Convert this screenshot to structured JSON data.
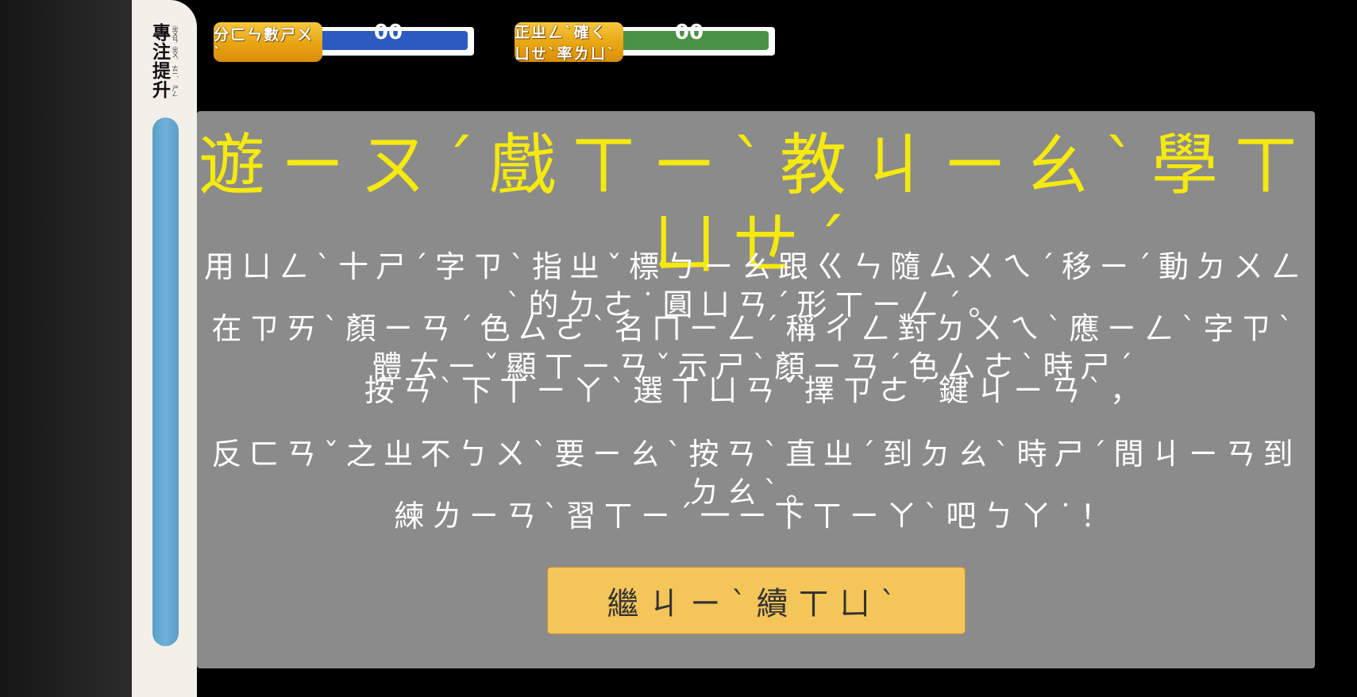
{
  "sidebar": {
    "title_chars": [
      {
        "han": "專",
        "bpmf": "ㄓㄨㄢ"
      },
      {
        "han": "注",
        "bpmf": "ㄓㄨˋ"
      },
      {
        "han": "提",
        "bpmf": "ㄊㄧˊ"
      },
      {
        "han": "升",
        "bpmf": "ㄕㄥ"
      }
    ],
    "progress_fraction": 1.0
  },
  "stats": {
    "score": {
      "label": "分ㄈㄣ數ㄕㄨˋ",
      "value": "00"
    },
    "accuracy": {
      "label": "正ㄓㄥˋ確ㄑㄩㄝˋ率ㄌㄩˋ",
      "value": "00"
    }
  },
  "dialog": {
    "title": "遊ㄧㄡˊ戲ㄒㄧˋ教ㄐㄧㄠˋ學ㄒㄩㄝˊ",
    "lines": [
      "用ㄩㄥˋ十ㄕˊ字ㄗˋ指ㄓˇ標ㄅㄧㄠ跟ㄍㄣ隨ㄙㄨㄟˊ移ㄧˊ動ㄉㄨㄥˋ的ㄉㄜ˙圓ㄩㄢˊ形ㄒㄧㄥˊ。",
      "在ㄗㄞˋ顏ㄧㄢˊ色ㄙㄜˋ名ㄇㄧㄥˊ稱ㄔㄥ對ㄉㄨㄟˋ應ㄧㄥˋ字ㄗˋ體ㄊㄧˇ顯ㄒㄧㄢˇ示ㄕˋ顏ㄧㄢˊ色ㄙㄜˋ時ㄕˊ",
      "按ㄢˋ下ㄒㄧㄚˋ選ㄒㄩㄢˇ擇ㄗㄜˊ鍵ㄐㄧㄢˋ，",
      "反ㄈㄢˇ之ㄓ不ㄅㄨˋ要ㄧㄠˋ按ㄢˋ直ㄓˊ到ㄉㄠˋ時ㄕˊ間ㄐㄧㄢ到ㄉㄠˋ。",
      "練ㄌㄧㄢˋ習ㄒㄧˊ一ㄧ下ㄒㄧㄚˋ吧ㄅㄚ˙！"
    ],
    "continue_label": "繼ㄐㄧˋ續ㄒㄩˋ"
  },
  "colors": {
    "title": "#f5e90f",
    "score_bar": "#2c5bbf",
    "accuracy_bar": "#4a9148",
    "button": "#f4c659",
    "panel": "#8b8b8b"
  }
}
